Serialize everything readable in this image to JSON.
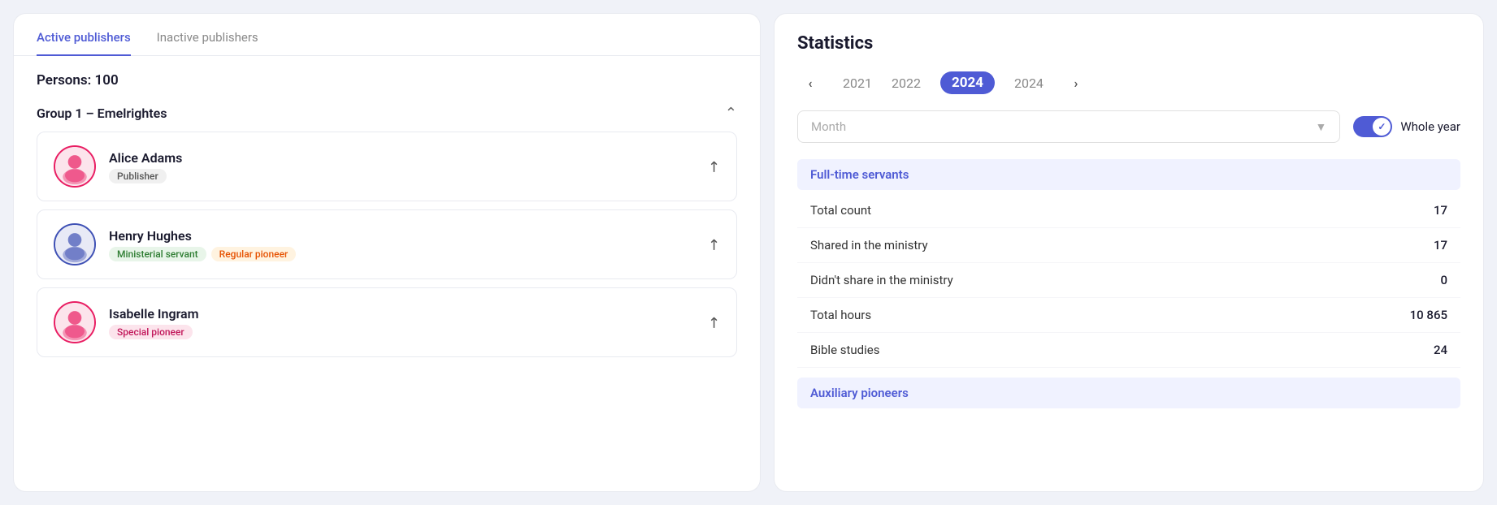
{
  "tabs": {
    "active": "Active publishers",
    "inactive": "Inactive publishers"
  },
  "persons": {
    "label": "Persons:",
    "count": "100"
  },
  "group": {
    "title": "Group 1 –  Emelrightes"
  },
  "people": [
    {
      "name": "Alice Adams",
      "badges": [
        {
          "label": "Publisher",
          "type": "gray"
        }
      ],
      "gender": "female"
    },
    {
      "name": "Henry Hughes",
      "badges": [
        {
          "label": "Ministerial servant",
          "type": "green"
        },
        {
          "label": "Regular pioneer",
          "type": "orange"
        }
      ],
      "gender": "male"
    },
    {
      "name": "Isabelle Ingram",
      "badges": [
        {
          "label": "Special pioneer",
          "type": "pink"
        }
      ],
      "gender": "female"
    }
  ],
  "stats": {
    "title": "Statistics",
    "years": [
      "2021",
      "2022",
      "2024",
      "2024"
    ],
    "active_year": "2024",
    "month_placeholder": "Month",
    "whole_year_label": "Whole year",
    "sections": [
      {
        "heading": "Full-time servants",
        "rows": [
          {
            "label": "Total count",
            "value": "17"
          },
          {
            "label": "Shared in the ministry",
            "value": "17"
          },
          {
            "label": "Didn't share in the ministry",
            "value": "0"
          },
          {
            "label": "Total hours",
            "value": "10 865"
          },
          {
            "label": "Bible studies",
            "value": "24"
          }
        ]
      },
      {
        "heading": "Auxiliary pioneers",
        "rows": []
      }
    ]
  }
}
